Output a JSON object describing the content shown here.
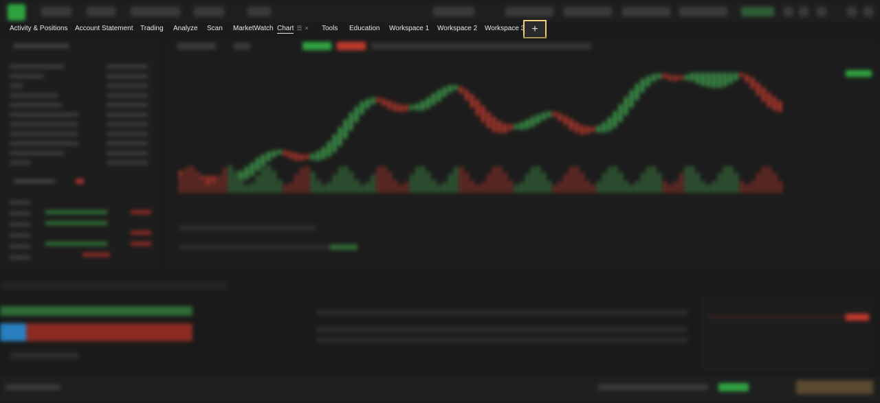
{
  "tabs": [
    {
      "label": "Activity & Positions"
    },
    {
      "label": "Account Statement"
    },
    {
      "label": "Trading"
    },
    {
      "label": "Analyze"
    },
    {
      "label": "Scan"
    },
    {
      "label": "MarketWatch"
    },
    {
      "label": "Chart",
      "active": true
    },
    {
      "label": "Tools"
    },
    {
      "label": "Education"
    },
    {
      "label": "Workspace 1"
    },
    {
      "label": "Workspace 2"
    },
    {
      "label": "Workspace 3"
    }
  ],
  "add_tab": {
    "label": "+",
    "icon": "plus-icon"
  },
  "colors": {
    "accent": "#2fa33f",
    "up": "#3fa34d",
    "down": "#c0392b",
    "highlight": "#f0d27a"
  }
}
